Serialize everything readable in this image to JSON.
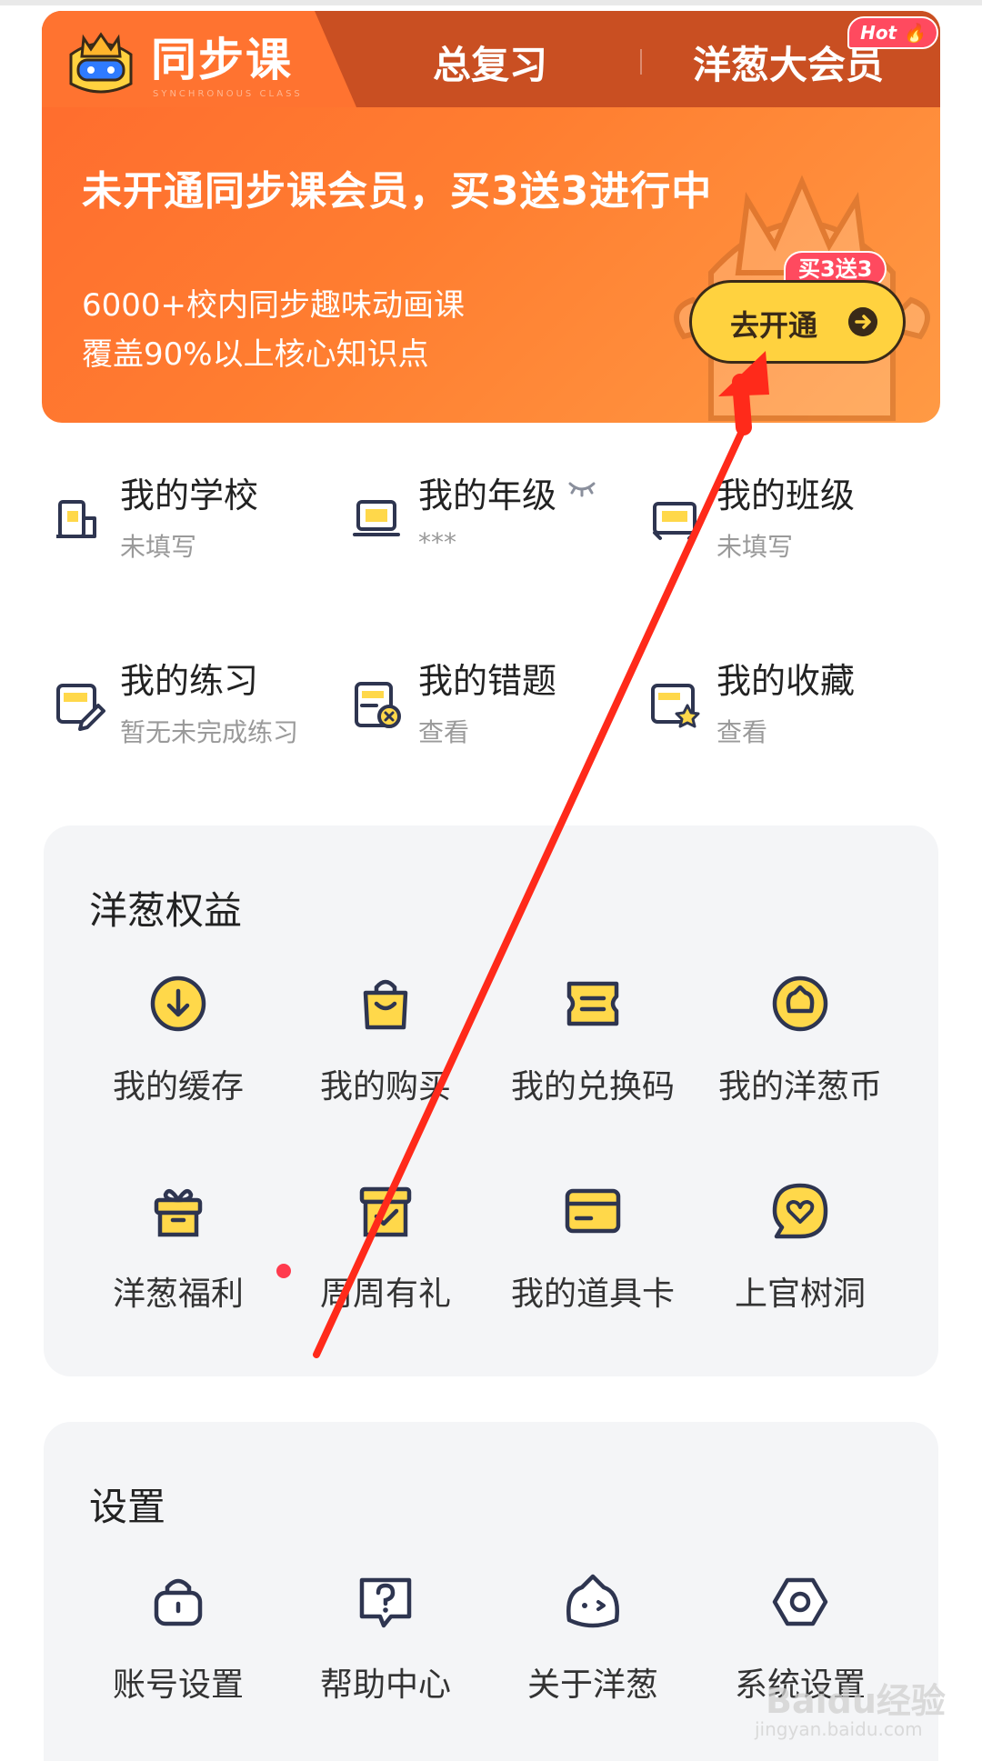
{
  "banner": {
    "tabs": [
      "同步课",
      "总复习",
      "洋葱大会员"
    ],
    "brand_sub": "SYNCHRONOUS CLASS",
    "hot_badge": "Hot",
    "title": "未开通同步课会员，买3送3进行中",
    "line1": "6000+校内同步趣味动画课",
    "line2": "覆盖90%以上核心知识点",
    "button_label": "去开通",
    "promo_tag": "买3送3",
    "colors": {
      "banner": "#ff7330",
      "button": "#ffd23f",
      "badge": "#ff4a5f"
    }
  },
  "profile": [
    {
      "title": "我的学校",
      "sub": "未填写",
      "icon": "school-icon"
    },
    {
      "title": "我的年级",
      "sub": "***",
      "icon": "grade-icon"
    },
    {
      "title": "我的班级",
      "sub": "未填写",
      "icon": "class-icon"
    },
    {
      "title": "我的练习",
      "sub": "暂无未完成练习",
      "icon": "practice-icon"
    },
    {
      "title": "我的错题",
      "sub": "查看",
      "icon": "mistakes-icon"
    },
    {
      "title": "我的收藏",
      "sub": "查看",
      "icon": "favorites-icon"
    }
  ],
  "benefits": {
    "title": "洋葱权益",
    "items": [
      {
        "label": "我的缓存",
        "icon": "download-icon"
      },
      {
        "label": "我的购买",
        "icon": "shopping-bag-icon"
      },
      {
        "label": "我的兑换码",
        "icon": "ticket-icon"
      },
      {
        "label": "我的洋葱币",
        "icon": "coin-icon"
      },
      {
        "label": "洋葱福利",
        "icon": "gift-icon"
      },
      {
        "label": "周周有礼",
        "icon": "gift-box-icon"
      },
      {
        "label": "我的道具卡",
        "icon": "card-icon"
      },
      {
        "label": "上官树洞",
        "icon": "heart-bubble-icon"
      }
    ]
  },
  "settings": {
    "title": "设置",
    "items": [
      {
        "label": "账号设置",
        "icon": "lock-icon"
      },
      {
        "label": "帮助中心",
        "icon": "help-icon"
      },
      {
        "label": "关于洋葱",
        "icon": "onion-icon"
      },
      {
        "label": "系统设置",
        "icon": "gear-icon"
      }
    ]
  },
  "watermark": {
    "text": "Baidu经验",
    "url": "jingyan.baidu.com"
  },
  "icon_color": {
    "stroke": "#2e3550",
    "fill": "#ffd84a",
    "annotation": "#ff2a1a"
  }
}
